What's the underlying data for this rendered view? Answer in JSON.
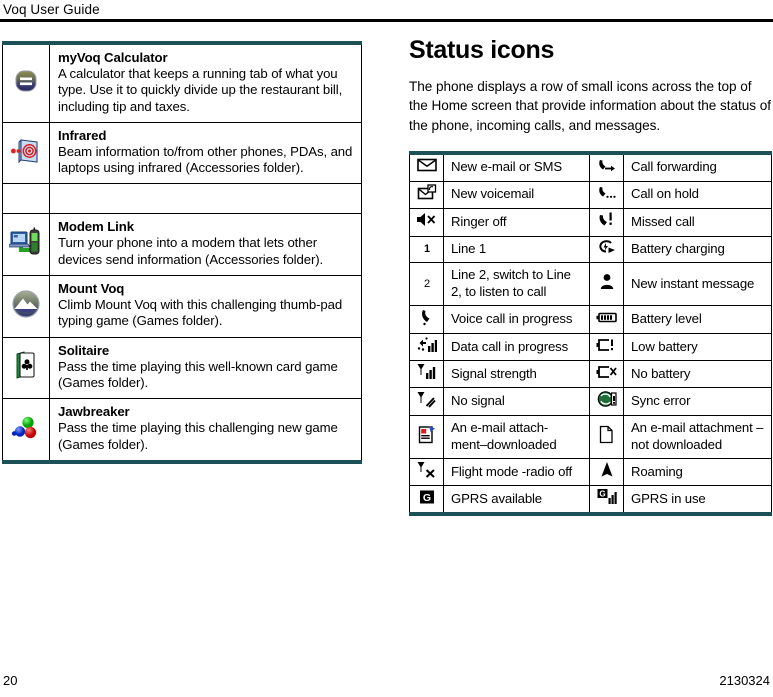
{
  "header": {
    "running_head": "Voq User Guide"
  },
  "footer": {
    "page_number": "20",
    "document_number": "2130324"
  },
  "colors": {
    "table_rule": "#1d5157",
    "header_rule": "#000000",
    "text": "#000000"
  },
  "applications_table": {
    "rows": [
      {
        "icon": "calculator-icon",
        "title": "myVoq Calculator",
        "description": "A calculator that keeps a running tab of what you type. Use it to quickly divide up the restaurant bill, including tip and taxes."
      },
      {
        "icon": "infrared-icon",
        "title": "Infrared",
        "description": "Beam information to/from other phones, PDAs, and laptops using infrared (Accessories folder)."
      },
      {
        "icon": "",
        "title": "",
        "description": ""
      },
      {
        "icon": "modem-link-icon",
        "title": "Modem Link",
        "description": "Turn your phone into a modem that lets other devices send information (Accessories folder)."
      },
      {
        "icon": "mount-voq-icon",
        "title": "Mount Voq",
        "description": "Climb Mount Voq with this challenging thumb-pad typing game (Games folder)."
      },
      {
        "icon": "solitaire-icon",
        "title": "Solitaire",
        "description": "Pass the time playing this well-known card game (Games folder)."
      },
      {
        "icon": "jawbreaker-icon",
        "title": "Jawbreaker",
        "description": "Pass the time playing this challenging new game (Games folder)."
      }
    ]
  },
  "status_section": {
    "title": "Status icons",
    "paragraph": "The phone displays a row of small icons across the top of the Home screen that provide information about the status of the phone, incoming calls, and messages.",
    "rows": [
      {
        "left_icon": "envelope-icon",
        "left_label": "New e-mail or SMS",
        "right_icon": "call-forwarding-icon",
        "right_label": "Call forwarding"
      },
      {
        "left_icon": "voicemail-icon",
        "left_label": "New voicemail",
        "right_icon": "call-on-hold-icon",
        "right_label": "Call on hold"
      },
      {
        "left_icon": "ringer-off-icon",
        "left_label": "Ringer off",
        "right_icon": "missed-call-icon",
        "right_label": "Missed call"
      },
      {
        "left_icon": "line-1-icon",
        "left_label": "Line 1",
        "right_icon": "battery-charging-icon",
        "right_label": "Battery charging"
      },
      {
        "left_icon": "line-2-icon",
        "left_label": "Line 2, switch to Line 2, to listen to call",
        "right_icon": "instant-message-icon",
        "right_label": "New instant message"
      },
      {
        "left_icon": "voice-call-icon",
        "left_label": "Voice call in progress",
        "right_icon": "battery-level-icon",
        "right_label": "Battery level"
      },
      {
        "left_icon": "data-call-icon",
        "left_label": "Data call in progress",
        "right_icon": "low-battery-icon",
        "right_label": "Low battery"
      },
      {
        "left_icon": "signal-strength-icon",
        "left_label": "Signal strength",
        "right_icon": "no-battery-icon",
        "right_label": "No battery"
      },
      {
        "left_icon": "no-signal-icon",
        "left_label": "No signal",
        "right_icon": "sync-error-icon",
        "right_label": "Sync error"
      },
      {
        "left_icon": "attachment-downloaded-icon",
        "left_label": "An e-mail attach-ment–downloaded",
        "right_icon": "attachment-not-downloaded-icon",
        "right_label": "An e-mail attachment – not downloaded"
      },
      {
        "left_icon": "flight-mode-icon",
        "left_label": "Flight mode -radio off",
        "right_icon": "roaming-icon",
        "right_label": "Roaming"
      },
      {
        "left_icon": "gprs-available-icon",
        "left_label": "GPRS available",
        "right_icon": "gprs-in-use-icon",
        "right_label": "GPRS in use"
      }
    ]
  }
}
